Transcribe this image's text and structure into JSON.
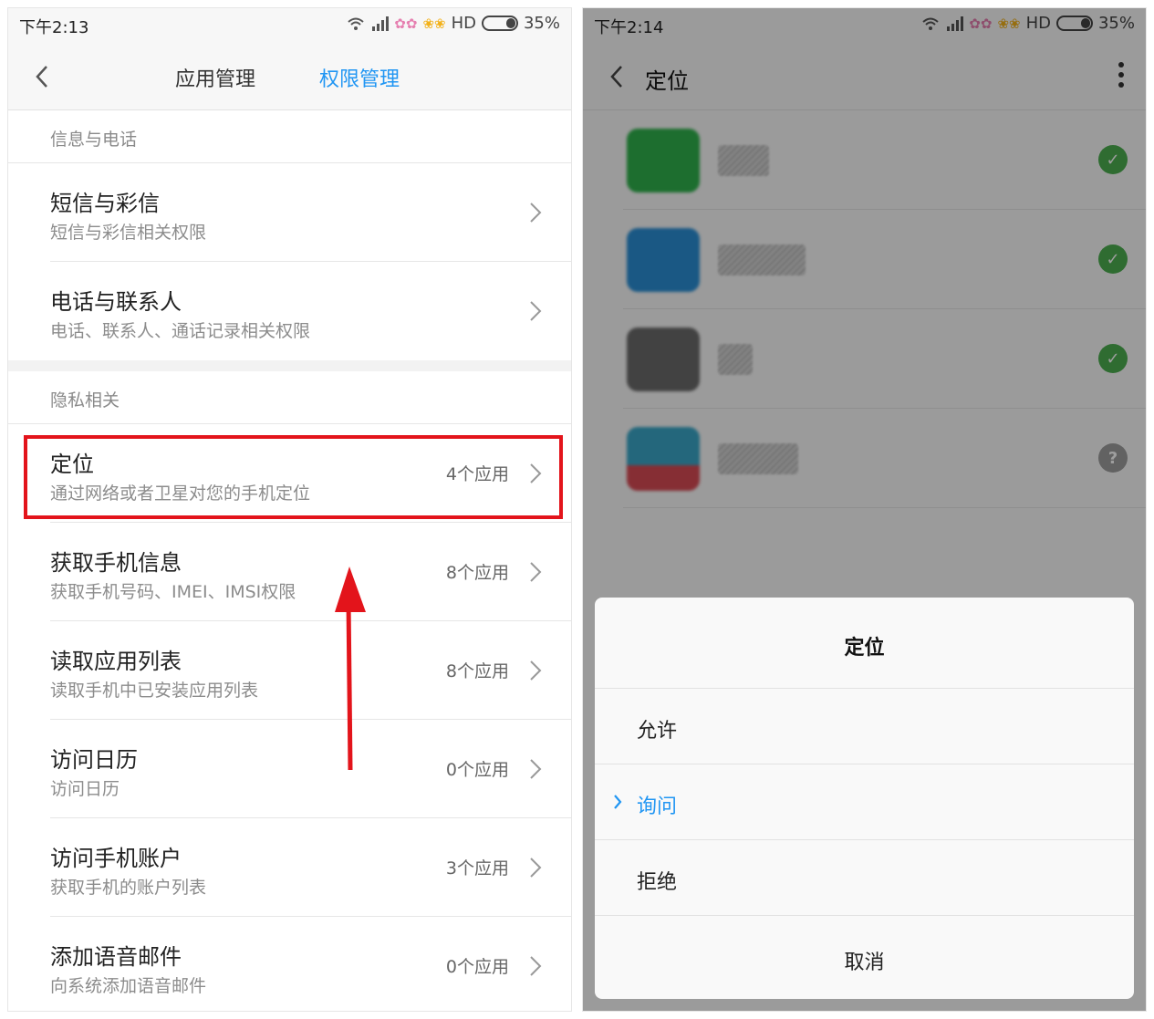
{
  "left": {
    "status": {
      "time": "下午2:13",
      "hd": "HD",
      "battery": "35%"
    },
    "header": {
      "tab_app": "应用管理",
      "tab_permission": "权限管理"
    },
    "sections": [
      {
        "title": "信息与电话"
      },
      {
        "title": "隐私相关"
      }
    ],
    "rows": [
      {
        "title": "短信与彩信",
        "sub": "短信与彩信相关权限",
        "count": ""
      },
      {
        "title": "电话与联系人",
        "sub": "电话、联系人、通话记录相关权限",
        "count": ""
      },
      {
        "title": "定位",
        "sub": "通过网络或者卫星对您的手机定位",
        "count": "4个应用"
      },
      {
        "title": "获取手机信息",
        "sub": "获取手机号码、IMEI、IMSI权限",
        "count": "8个应用"
      },
      {
        "title": "读取应用列表",
        "sub": "读取手机中已安装应用列表",
        "count": "8个应用"
      },
      {
        "title": "访问日历",
        "sub": "访问日历",
        "count": "0个应用"
      },
      {
        "title": "访问手机账户",
        "sub": "获取手机的账户列表",
        "count": "3个应用"
      },
      {
        "title": "添加语音邮件",
        "sub": "向系统添加语音邮件",
        "count": "0个应用"
      }
    ]
  },
  "right": {
    "status": {
      "time": "下午2:14",
      "hd": "HD",
      "battery": "35%"
    },
    "page_title": "定位",
    "apps": [
      {
        "status_icon": "check-icon",
        "icon_color": "#2fb24c"
      },
      {
        "status_icon": "check-icon",
        "icon_color": "#2a8fd6"
      },
      {
        "status_icon": "check-icon",
        "icon_color": "#6b6b6b"
      },
      {
        "status_icon": "question-icon",
        "icon_color": "#3aa7c9"
      }
    ],
    "dialog": {
      "title": "定位",
      "options": [
        "允许",
        "询问",
        "拒绝"
      ],
      "selected": "询问",
      "cancel": "取消"
    }
  },
  "colors": {
    "accent": "#2196f3",
    "highlight": "#e3141b",
    "ok": "#4caf50"
  }
}
